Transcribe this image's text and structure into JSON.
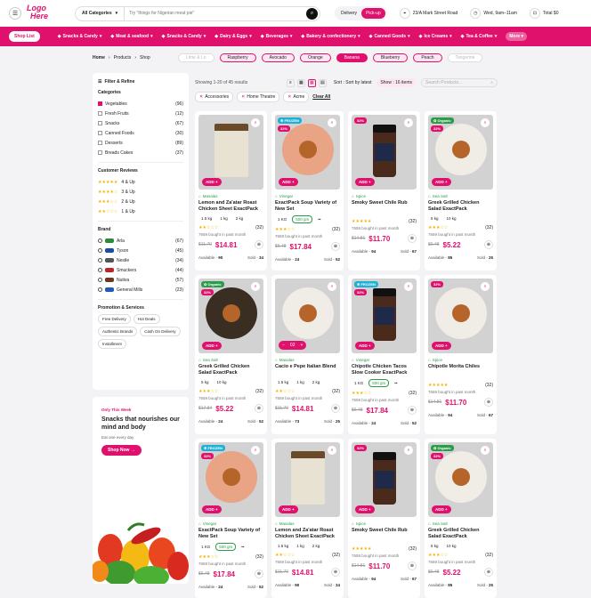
{
  "header": {
    "logo_line1": "Logo",
    "logo_line2": "Here",
    "category_select": "All Categories",
    "search_placeholder": "Try \"things for Nigerian meat pie\"",
    "delivery": "Delivery",
    "pickup": "Pick-up",
    "address": "23/A Mark Street Road",
    "time": "Wed, 9am–11am",
    "total": "Total $0"
  },
  "catbar": {
    "shop_list": "Shop List",
    "items": [
      "Snacks & Candy",
      "Meat & seafood",
      "Snacks & Candy",
      "Dairy & Eggs",
      "Beverages",
      "Bakery & confectionery",
      "Canned Goods",
      "Ice Creams",
      "Tea & Coffee"
    ],
    "more": "More"
  },
  "breadcrumb": [
    "Home",
    "Products",
    "Shop"
  ],
  "fruit_chips": [
    "Lime & Lo",
    "Raspberry",
    "Avocado",
    "Orange",
    "Banana",
    "Blueberry",
    "Peach",
    "Tangerine"
  ],
  "fruit_selected": 4,
  "sidebar": {
    "title": "Filter & Refine",
    "categories_title": "Categories",
    "categories": [
      {
        "label": "Vegetables",
        "count": "(96)",
        "checked": true
      },
      {
        "label": "Fresh Fruits",
        "count": "(12)",
        "checked": false
      },
      {
        "label": "Snacks",
        "count": "(67)",
        "checked": false
      },
      {
        "label": "Canned Foods",
        "count": "(30)",
        "checked": false
      },
      {
        "label": "Desserts",
        "count": "(89)",
        "checked": false
      },
      {
        "label": "Breads Cakes",
        "count": "(37)",
        "checked": false
      }
    ],
    "reviews_title": "Customer Reviews",
    "reviews": [
      {
        "stars": "★★★★★",
        "label": "4 & Up"
      },
      {
        "stars": "★★★★☆",
        "label": "3 & Up"
      },
      {
        "stars": "★★★☆☆",
        "label": "2 & Up"
      },
      {
        "stars": "★★☆☆☆",
        "label": "1 & Up"
      }
    ],
    "brand_title": "Brand",
    "brands": [
      {
        "label": "Arla",
        "count": "(67)",
        "color": "#2a8c3a"
      },
      {
        "label": "Tyson",
        "count": "(45)",
        "color": "#1a4fa0"
      },
      {
        "label": "Nestle",
        "count": "(34)",
        "color": "#555555"
      },
      {
        "label": "Smuckers",
        "count": "(44)",
        "color": "#b8252a"
      },
      {
        "label": "Nutiva",
        "count": "(57)",
        "color": "#6b3a1e"
      },
      {
        "label": "General Mills",
        "count": "(23)",
        "color": "#1e5bb8"
      }
    ],
    "promo_title": "Promotion & Services",
    "promo_tags": [
      "Free Delivery",
      "Hot Deals",
      "Authentic Brands",
      "Cash On Delivery",
      "Installment"
    ]
  },
  "promo": {
    "tag": "Only This Week",
    "title": "Snacks that nourishes our mind and body",
    "sub": "Eat one every day",
    "button": "Shop Now →"
  },
  "toolbar": {
    "results": "Showing 1-20 of 45 results",
    "sort": "Sort : Sort by latest",
    "show": "Show : 16 items",
    "search_placeholder": "Search Products..."
  },
  "active_filters": [
    "Accessories",
    "Home Theatre",
    "Acme"
  ],
  "clear_all": "Clear All",
  "products": [
    {
      "badge": "",
      "discount": "",
      "cat": "Masalas",
      "name": "Lemon and Za'atar Roast Chicken Sheet ExactPack",
      "sizes": [
        "1.5 kg",
        "1 kg",
        "2 kg"
      ],
      "rating": "★★☆☆☆",
      "reviews": "(32)",
      "bought": "7659 bought in past month",
      "old": "$11.70",
      "new": "$14.81",
      "available": "90",
      "sold": "34",
      "img": "bag",
      "plate": "",
      "qty": false
    },
    {
      "badge": "FROZEN",
      "discount": "32%",
      "cat": "Vinegar",
      "name": "ExactPack Soup Variety of New Set",
      "sizes": [
        "1 KG",
        "500 gm",
        "••"
      ],
      "rating": "★★★☆☆",
      "reviews": "(32)",
      "bought": "7659 bought in past month",
      "old": "$6.48",
      "new": "$17.84",
      "available": "24",
      "sold": "52",
      "img": "plate",
      "plate": "#e8a484",
      "qty": false
    },
    {
      "badge": "",
      "discount": "32%",
      "cat": "Spice",
      "name": "Smoky Sweet Chile Rub",
      "sizes": [],
      "rating": "★★★★★",
      "reviews": "(32)",
      "bought": "7659 bought in past month",
      "old": "$14.81",
      "new": "$11.70",
      "available": "94",
      "sold": "67",
      "img": "jar",
      "plate": "",
      "qty": false
    },
    {
      "badge": "Organic",
      "discount": "32%",
      "cat": "Sea Salt",
      "name": "Greek Grilled Chicken Salad ExactPack",
      "sizes": [
        "5 kg",
        "10 kg"
      ],
      "rating": "★★★☆☆",
      "reviews": "(32)",
      "bought": "7659 bought in past month",
      "old": "$6.48",
      "new": "$5.22",
      "available": "85",
      "sold": "25",
      "img": "plate",
      "plate": "#f0ece6",
      "qty": false
    },
    {
      "badge": "Organic",
      "discount": "32%",
      "cat": "Sea Salt",
      "name": "Greek Grilled Chicken Salad ExactPack",
      "sizes": [
        "5 kg",
        "10 kg"
      ],
      "rating": "★★★☆☆",
      "reviews": "(32)",
      "bought": "7659 bought in past month",
      "old": "$17.84",
      "new": "$5.22",
      "available": "24",
      "sold": "52",
      "img": "plate",
      "plate": "#3a2e22",
      "qty": false
    },
    {
      "badge": "",
      "discount": "",
      "cat": "Masalas",
      "name": "Cacio e Pepe Italian Blend",
      "sizes": [
        "1.5 kg",
        "1 kg",
        "2 kg"
      ],
      "rating": "★★☆☆☆",
      "reviews": "(32)",
      "bought": "7659 bought in past month",
      "old": "$11.70",
      "new": "$14.81",
      "available": "73",
      "sold": "25",
      "img": "plate",
      "plate": "#f0ece6",
      "qty": true
    },
    {
      "badge": "FROZEN",
      "discount": "32%",
      "cat": "Vinegar",
      "name": "Chipotle Chicken Tacos Slow Cooker ExactPack",
      "sizes": [
        "1 KG",
        "500 gm",
        "••"
      ],
      "rating": "★★★☆☆",
      "reviews": "(32)",
      "bought": "7659 bought in past month",
      "old": "$6.48",
      "new": "$17.84",
      "available": "24",
      "sold": "52",
      "img": "jar",
      "plate": "",
      "qty": false
    },
    {
      "badge": "",
      "discount": "32%",
      "cat": "Spice",
      "name": "Chipotle Morita Chiles",
      "sizes": [],
      "rating": "★★★★★",
      "reviews": "(32)",
      "bought": "7659 bought in past month",
      "old": "$14.81",
      "new": "$11.70",
      "available": "94",
      "sold": "67",
      "img": "plate",
      "plate": "#f0ece6",
      "qty": false
    },
    {
      "badge": "FROZEN",
      "discount": "32%",
      "cat": "Vinegar",
      "name": "ExactPack Soup Variety of New Set",
      "sizes": [
        "1 KG",
        "500 gm",
        "••"
      ],
      "rating": "★★★☆☆",
      "reviews": "(32)",
      "bought": "7659 bought in past month",
      "old": "$6.48",
      "new": "$17.84",
      "available": "24",
      "sold": "52",
      "img": "plate",
      "plate": "#e8a484",
      "qty": false
    },
    {
      "badge": "",
      "discount": "",
      "cat": "Masalas",
      "name": "Lemon and Za'atar Roast Chicken Sheet ExactPack",
      "sizes": [
        "1.5 kg",
        "1 kg",
        "2 kg"
      ],
      "rating": "★★☆☆☆",
      "reviews": "(32)",
      "bought": "7659 bought in past month",
      "old": "$11.70",
      "new": "$14.81",
      "available": "90",
      "sold": "34",
      "img": "bag",
      "plate": "",
      "qty": false
    },
    {
      "badge": "",
      "discount": "32%",
      "cat": "Spice",
      "name": "Smoky Sweet Chile Rub",
      "sizes": [],
      "rating": "★★★★★",
      "reviews": "(32)",
      "bought": "7659 bought in past month",
      "old": "$14.81",
      "new": "$11.70",
      "available": "94",
      "sold": "67",
      "img": "jar",
      "plate": "",
      "qty": false
    },
    {
      "badge": "Organic",
      "discount": "32%",
      "cat": "Sea Salt",
      "name": "Greek Grilled Chicken Salad ExactPack",
      "sizes": [
        "5 kg",
        "10 kg"
      ],
      "rating": "★★★☆☆",
      "reviews": "(32)",
      "bought": "7659 bought in past month",
      "old": "$6.48",
      "new": "$5.22",
      "available": "85",
      "sold": "25",
      "img": "plate",
      "plate": "#f0ece6",
      "qty": false
    }
  ],
  "labels": {
    "add": "ADD +",
    "available": "Available -",
    "sold": "Sold -"
  },
  "colors": {
    "accent": "#e0116c",
    "organic": "#2a9d4a",
    "frozen": "#1fb0d8"
  }
}
